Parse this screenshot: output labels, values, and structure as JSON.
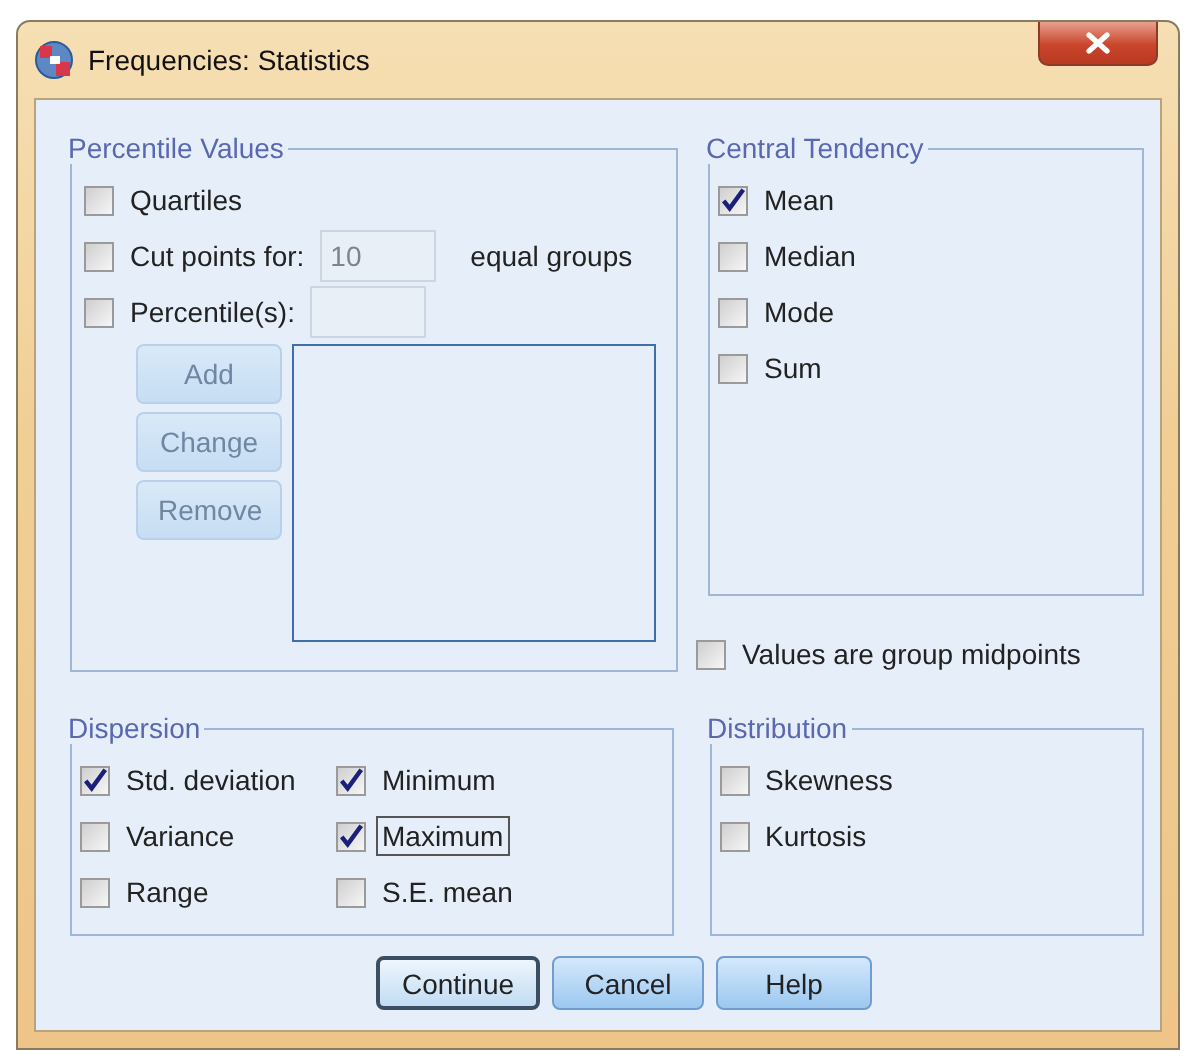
{
  "window": {
    "title": "Frequencies: Statistics"
  },
  "percentile_values": {
    "title": "Percentile Values",
    "options": [
      {
        "kind": "plain",
        "label": "Quartiles",
        "checked": false
      },
      {
        "kind": "field",
        "label": "Cut points for:",
        "checked": false,
        "field": {
          "value": "10",
          "disabled": true
        },
        "suffix": "equal groups"
      },
      {
        "kind": "field",
        "label": "Percentile(s):",
        "checked": false,
        "field": {
          "disabled": true
        }
      }
    ],
    "buttons": [
      {
        "label": "Add",
        "disabled": true
      },
      {
        "label": "Change",
        "disabled": true
      },
      {
        "label": "Remove",
        "disabled": true
      }
    ]
  },
  "central_tendency": {
    "title": "Central Tendency",
    "options": [
      {
        "label": "Mean",
        "checked": true
      },
      {
        "label": "Median",
        "checked": false
      },
      {
        "label": "Mode",
        "checked": false
      },
      {
        "label": "Sum",
        "checked": false
      }
    ]
  },
  "group_midpoints": {
    "label": "Values are group midpoints",
    "checked": false
  },
  "dispersion": {
    "title": "Dispersion",
    "options": [
      {
        "label": "Std. deviation",
        "checked": true,
        "focused": false
      },
      {
        "label": "Minimum",
        "checked": true,
        "focused": false
      },
      {
        "label": "Variance",
        "checked": false,
        "focused": false
      },
      {
        "label": "Maximum",
        "checked": true,
        "focused": true
      },
      {
        "label": "Range",
        "checked": false,
        "focused": false
      },
      {
        "label": "S.E. mean",
        "checked": false,
        "focused": false
      }
    ]
  },
  "distribution": {
    "title": "Distribution",
    "options": [
      {
        "label": "Skewness",
        "checked": false
      },
      {
        "label": "Kurtosis",
        "checked": false
      }
    ]
  },
  "buttons": [
    {
      "label": "Continue",
      "default": true
    },
    {
      "label": "Cancel",
      "default": false
    },
    {
      "label": "Help",
      "default": false
    }
  ]
}
